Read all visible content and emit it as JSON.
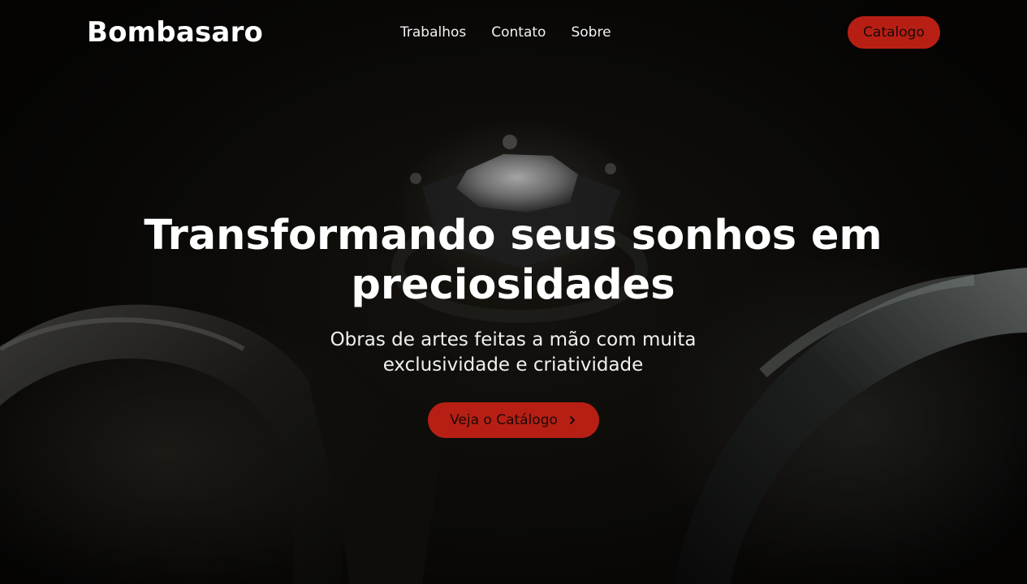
{
  "brand": {
    "name": "Bombasaro",
    "accent_color": "#b81f14"
  },
  "nav": {
    "links": [
      {
        "label": "Trabalhos"
      },
      {
        "label": "Contato"
      },
      {
        "label": "Sobre"
      }
    ],
    "cta_label": "Catalogo"
  },
  "hero": {
    "headline": "Transformando seus sonhos em preciosidades",
    "subtitle": "Obras de artes feitas a mão com muita exclusividade e criatividade",
    "cta_label": "Veja o Catálogo",
    "cta_icon": "chevron-right-icon",
    "background_image": "rings-with-diamond-photo"
  }
}
